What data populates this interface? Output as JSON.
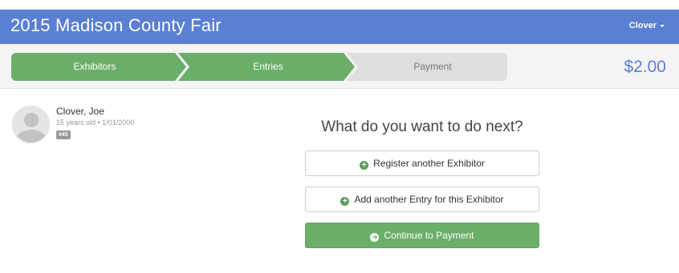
{
  "header": {
    "title": "2015 Madison County Fair",
    "user_label": "Clover"
  },
  "steps": [
    {
      "label": "Exhibitors",
      "state": "complete"
    },
    {
      "label": "Entries",
      "state": "complete"
    },
    {
      "label": "Payment",
      "state": "pending"
    }
  ],
  "cart": {
    "total": "$2.00"
  },
  "exhibitor": {
    "name": "Clover, Joe",
    "meta": "15 years old • 1/01/2000",
    "badge": "#45"
  },
  "next": {
    "question": "What do you want to do next?",
    "actions": [
      {
        "label": "Register another Exhibitor",
        "icon": "plus-circle-icon"
      },
      {
        "label": "Add another Entry for this Exhibitor",
        "icon": "plus-circle-icon"
      },
      {
        "label": "Continue to Payment",
        "icon": "arrow-right-circle-icon"
      }
    ]
  },
  "colors": {
    "header": "#5a7fd3",
    "step_complete": "#6aaf69",
    "step_pending": "#dedede",
    "total_text": "#5a7fd3",
    "primary_button": "#6aaf69"
  }
}
